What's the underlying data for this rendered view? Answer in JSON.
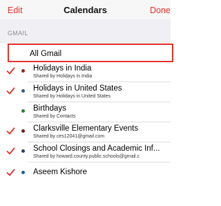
{
  "nav": {
    "left_label": "Edit",
    "title": "Calendars",
    "right_label": "Done"
  },
  "section": {
    "label": "GMAIL"
  },
  "all_row": {
    "label": "All Gmail"
  },
  "calendars": [
    {
      "name": "Holidays in India",
      "subtitle": "Shared by Holidays in India",
      "checked": true,
      "dot_color": "#8b2c1d"
    },
    {
      "name": "Holidays in United States",
      "subtitle": "Shared by Holidays in United States",
      "checked": true,
      "dot_color": "#3c5a8a"
    },
    {
      "name": "Birthdays",
      "subtitle": "Shared by Contacts",
      "checked": false,
      "dot_color": "#2e7d32"
    },
    {
      "name": "Clarksville Elementary Events",
      "subtitle": "Shared by ces12041@gmail.com",
      "checked": true,
      "dot_color": "#7a1f1f"
    },
    {
      "name": "School Closings and Academic Inf...",
      "subtitle": "Shared by howard.county.public.schools@gmail.c",
      "checked": true,
      "dot_color": "#2b3f6b"
    },
    {
      "name": "Aseem Kishore",
      "subtitle": "",
      "checked": true,
      "dot_color": "#1e5ea8"
    }
  ],
  "colors": {
    "accent": "#e5312a",
    "highlight_border": "#e2342d",
    "separator": "#dcdcdf",
    "section_bg": "#efeff4"
  }
}
